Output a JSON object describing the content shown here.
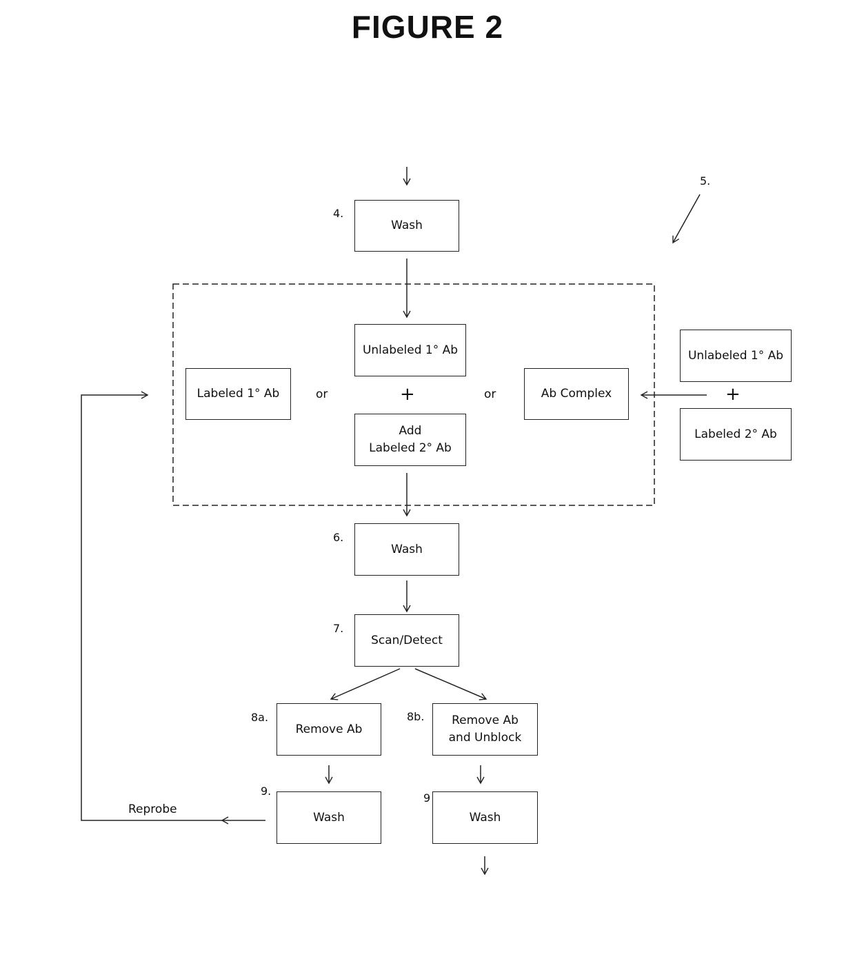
{
  "title": "FIGURE 2",
  "steps": {
    "wash4": {
      "num": "4.",
      "label": "Wash"
    },
    "step5": {
      "num": "5."
    },
    "labeled1": {
      "label": "Labeled 1° Ab"
    },
    "unlabeled1": {
      "label": "Unlabeled 1° Ab"
    },
    "add2": {
      "label": "Add\nLabeled 2° Ab"
    },
    "complex": {
      "label": "Ab Complex"
    },
    "ext_unlabeled1": {
      "label": "Unlabeled 1° Ab"
    },
    "ext_labeled2": {
      "label": "Labeled 2° Ab"
    },
    "wash6": {
      "num": "6.",
      "label": "Wash"
    },
    "scan7": {
      "num": "7.",
      "label": "Scan/Detect"
    },
    "remove8a": {
      "num": "8a.",
      "label": "Remove Ab"
    },
    "remove8b": {
      "num": "8b.",
      "label": "Remove Ab\nand Unblock"
    },
    "wash9a": {
      "num": "9.",
      "label": "Wash"
    },
    "wash9b": {
      "num": "9",
      "label": "Wash"
    }
  },
  "connectors": {
    "or": "or",
    "plus": "+",
    "reprobe": "Reprobe"
  }
}
